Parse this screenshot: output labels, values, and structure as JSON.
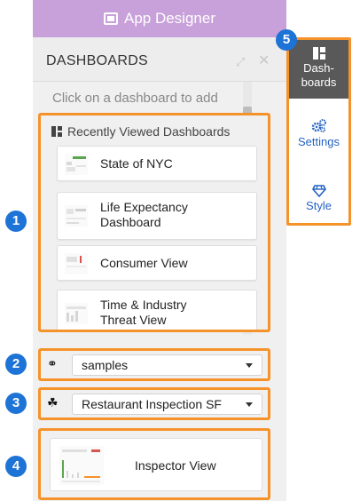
{
  "header": {
    "title": "App Designer"
  },
  "panel": {
    "title": "DASHBOARDS",
    "hint": "Click on a dashboard to add",
    "recent_heading": "Recently Viewed Dashboards",
    "recent": [
      {
        "label": "State of NYC"
      },
      {
        "label": "Life Expectancy Dashboard"
      },
      {
        "label": "Consumer View"
      },
      {
        "label": "Time & Industry Threat View"
      }
    ],
    "source_select": {
      "value": "samples"
    },
    "dataset_select": {
      "value": "Restaurant Inspection SF"
    },
    "dataset_card": {
      "label": "Inspector View"
    }
  },
  "tabs": [
    {
      "label": "Dash-\nboards",
      "icon": "dashboard-icon",
      "active": true
    },
    {
      "label": "Settings",
      "icon": "gears-icon"
    },
    {
      "label": "Style",
      "icon": "diamond-icon"
    }
  ],
  "badges": [
    "1",
    "2",
    "3",
    "4",
    "5"
  ],
  "colors": {
    "header": "#c8a0da",
    "highlight": "#f5922a",
    "badge": "#1e73d6",
    "active_tab": "#595959",
    "link": "#2563c4"
  }
}
